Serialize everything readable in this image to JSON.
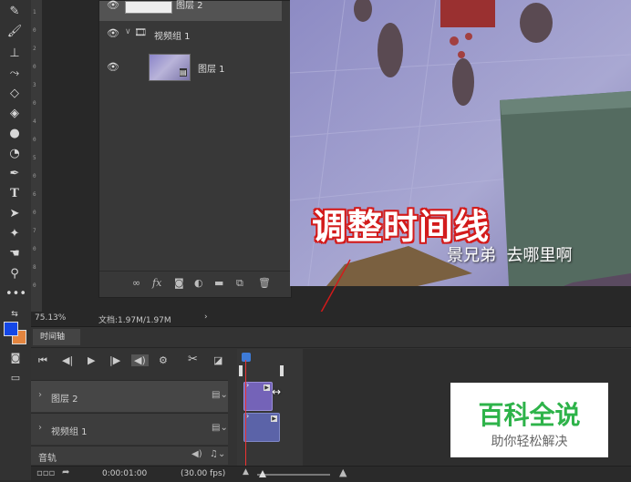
{
  "status_bar": {
    "zoom": "75.13%",
    "doc_info": "文档:1.97M/1.97M",
    "arrow": "›"
  },
  "layers_panel": {
    "layers": [
      {
        "name": "图层 2",
        "visible": true
      },
      {
        "name": "视频组 1",
        "visible": true,
        "type": "video-group",
        "expanded": true
      },
      {
        "name": "图层 1",
        "visible": true,
        "type": "video-clip"
      }
    ],
    "footer_icons": [
      "link-icon",
      "fx-icon",
      "mask-icon",
      "adjustment-icon",
      "folder-icon",
      "new-layer-icon",
      "trash-icon"
    ],
    "fx_label": "fx"
  },
  "video": {
    "annotation": "调整时间线",
    "subtitle": "景兄弟  去哪里啊"
  },
  "timeline": {
    "tab_label": "时间轴",
    "tracks": [
      {
        "label": "图层 2"
      },
      {
        "label": "视频组 1"
      }
    ],
    "audio_label": "音轨",
    "timecode": "0:00:01:00",
    "fps": "(30.00 fps)"
  },
  "watermark": {
    "title": "百科全说",
    "subtitle": "助你轻松解决"
  },
  "colors": {
    "foreground": "#1447e6",
    "background": "#e3843e",
    "annotation": "#d31a1a",
    "clip": "#6b5fb0"
  }
}
